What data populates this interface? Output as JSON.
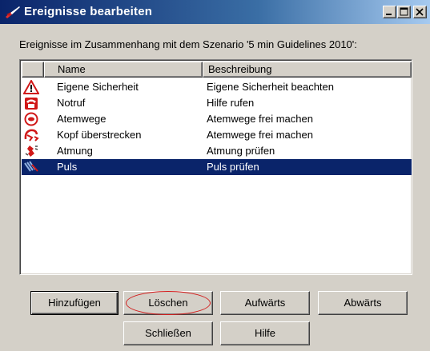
{
  "window": {
    "title": "Ereignisse bearbeiten",
    "title_icon": "red-brush-icon",
    "controls": [
      "minimize-icon",
      "maximize-icon",
      "close-icon"
    ]
  },
  "description": "Ereignisse im Zusammenhang mit dem Szenario '5 min Guidelines 2010':",
  "list": {
    "columns": [
      "",
      "Name",
      "Beschreibung"
    ],
    "rows": [
      {
        "icon": "warning-triangle-icon",
        "name": "Eigene Sicherheit",
        "beschreibung": "Eigene Sicherheit beachten",
        "selected": false
      },
      {
        "icon": "telephone-icon",
        "name": "Notruf",
        "beschreibung": "Hilfe rufen",
        "selected": false
      },
      {
        "icon": "airway-icon",
        "name": "Atemwege",
        "beschreibung": "Atemwege frei machen",
        "selected": false
      },
      {
        "icon": "head-tilt-icon",
        "name": "Kopf überstrecken",
        "beschreibung": "Atemwege frei machen",
        "selected": false
      },
      {
        "icon": "breathing-icon",
        "name": "Atmung",
        "beschreibung": "Atmung prüfen",
        "selected": false
      },
      {
        "icon": "pulse-icon",
        "name": "Puls",
        "beschreibung": "Puls prüfen",
        "selected": true
      }
    ]
  },
  "buttons": {
    "add": "Hinzufügen",
    "delete": "Löschen",
    "up": "Aufwärts",
    "down": "Abwärts",
    "close": "Schließen",
    "help": "Hilfe"
  },
  "colors": {
    "selection": "#0a246a",
    "annotation": "#d21e1e",
    "icon_red": "#d01818"
  }
}
